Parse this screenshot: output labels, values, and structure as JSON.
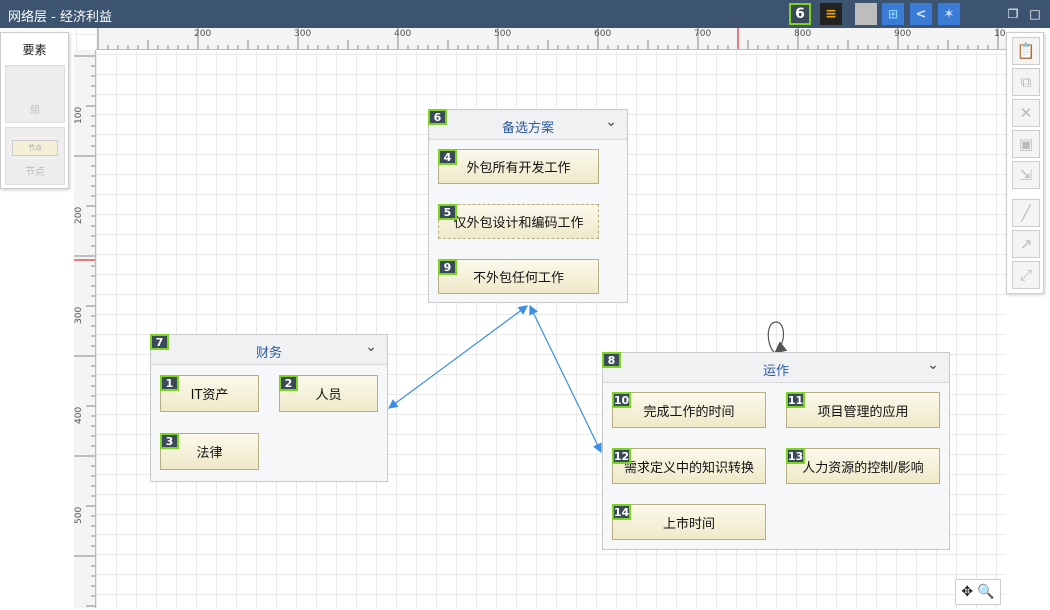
{
  "window": {
    "title": "网络层 - 经济利益"
  },
  "toolbar": {
    "count_badge": "6"
  },
  "palette": {
    "title": "要素",
    "items": [
      {
        "label": "组"
      },
      {
        "label": "节点",
        "preview": "节点"
      }
    ]
  },
  "ruler": {
    "top": [
      "200",
      "300",
      "400",
      "500",
      "600",
      "700",
      "800",
      "900",
      "100"
    ],
    "left": [
      "100",
      "200",
      "300",
      "400",
      "500"
    ]
  },
  "groups": [
    {
      "num": "6",
      "title": "备选方案",
      "nodes": [
        {
          "num": "4",
          "label": "外包所有开发工作"
        },
        {
          "num": "5",
          "label": "仅外包设计和编码工作"
        },
        {
          "num": "9",
          "label": "不外包任何工作"
        }
      ]
    },
    {
      "num": "7",
      "title": "财务",
      "nodes": [
        {
          "num": "1",
          "label": "IT资产"
        },
        {
          "num": "2",
          "label": "人员"
        },
        {
          "num": "3",
          "label": "法律"
        }
      ]
    },
    {
      "num": "8",
      "title": "运作",
      "nodes": [
        {
          "num": "10",
          "label": "完成工作的时间"
        },
        {
          "num": "11",
          "label": "项目管理的应用"
        },
        {
          "num": "12",
          "label": "需求定义中的知识转换"
        },
        {
          "num": "13",
          "label": "人力资源的控制/影响"
        },
        {
          "num": "14",
          "label": "上市时间"
        }
      ]
    }
  ],
  "colors": {
    "titlebar": "#3c5470",
    "accent_blue": "#2c5aa0",
    "badge_border": "#7ed321",
    "link": "#3a8ee6"
  }
}
